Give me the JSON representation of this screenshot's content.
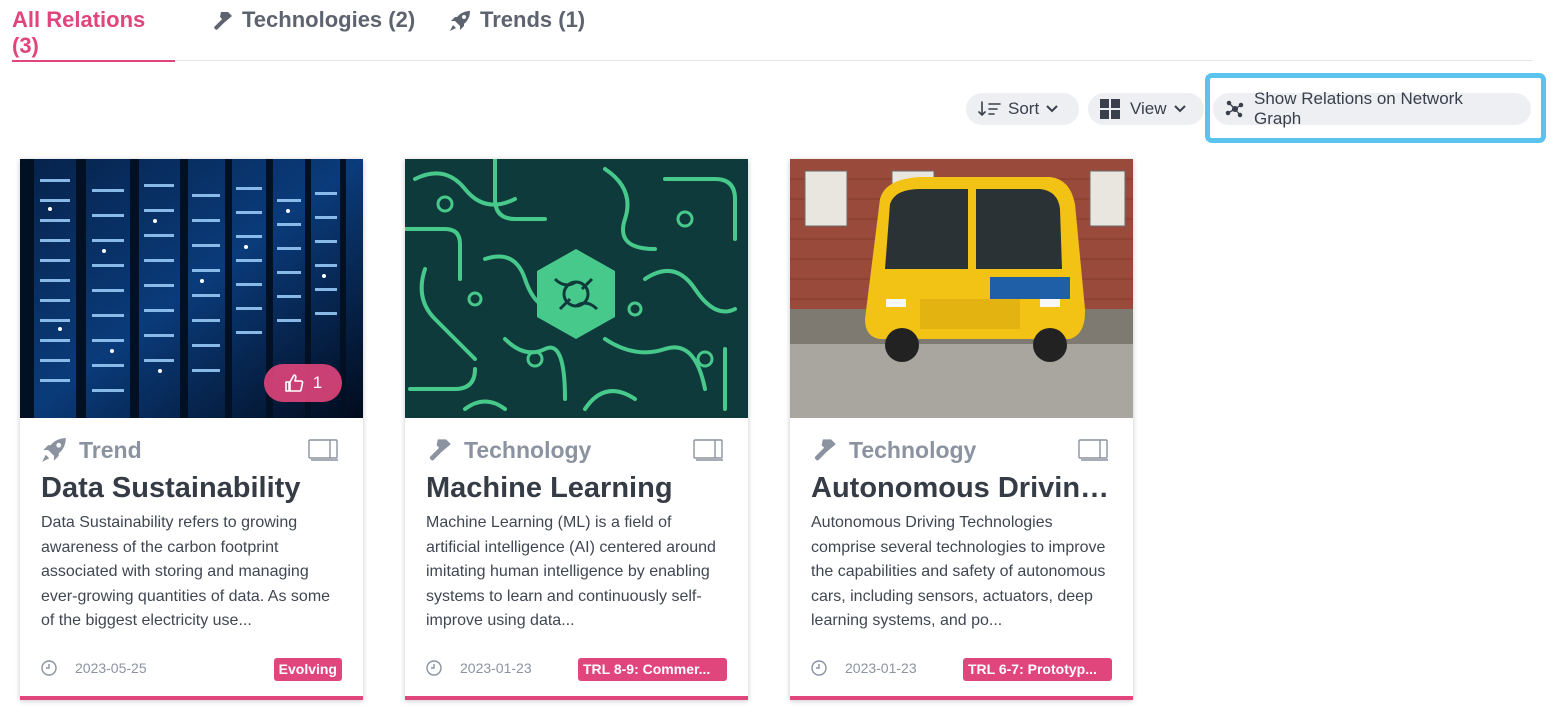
{
  "tabs": [
    {
      "label": "All Relations (3)",
      "icon": "none",
      "active": true
    },
    {
      "label": "Technologies (2)",
      "icon": "hammer-icon",
      "active": false
    },
    {
      "label": "Trends (1)",
      "icon": "rocket-icon",
      "active": false
    }
  ],
  "toolbar": {
    "sort_label": "Sort",
    "view_label": "View",
    "graph_label": "Show Relations on Network Graph"
  },
  "colors": {
    "accent": "#e0457b",
    "highlight": "#5ac4ee",
    "muted": "#8b93a0"
  },
  "cards": [
    {
      "type": "Trend",
      "type_icon": "rocket-icon",
      "title": "Data Sustainability",
      "description": "Data Sustainability refers to growing awareness of the carbon footprint associated with storing and managing ever-growing quantities of data. As some of the biggest electricity use...",
      "date": "2023-05-25",
      "badge": "Evolving",
      "likes": "1",
      "image": "server-racks-blue-lights"
    },
    {
      "type": "Technology",
      "type_icon": "hammer-icon",
      "title": "Machine Learning",
      "description": "Machine Learning (ML) is a field of artificial intelligence (AI) centered around imitating human intelligence by enabling systems to learn and continuously self-improve using data...",
      "date": "2023-01-23",
      "badge": "TRL 8-9: Commer...",
      "image": "green-circuit-pattern"
    },
    {
      "type": "Technology",
      "type_icon": "hammer-icon",
      "title": "Autonomous Driving ...",
      "description": "Autonomous Driving Technologies comprise several technologies to improve the capabilities and safety of autonomous cars, including sensors, actuators, deep learning systems, and po...",
      "date": "2023-01-23",
      "badge": "TRL 6-7: Prototyp...",
      "image": "yellow-autonomous-shuttle-bus"
    }
  ]
}
